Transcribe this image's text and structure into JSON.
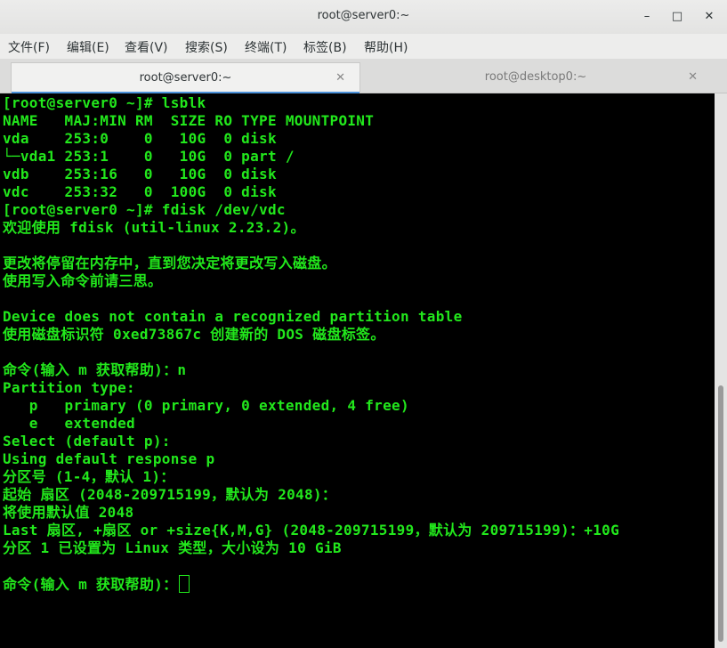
{
  "window": {
    "title": "root@server0:~",
    "controls": {
      "minimize": "–",
      "maximize": "□",
      "close": "✕"
    }
  },
  "menu": [
    "文件(F)",
    "编辑(E)",
    "查看(V)",
    "搜索(S)",
    "终端(T)",
    "标签(B)",
    "帮助(H)"
  ],
  "tabs": [
    {
      "label": "root@server0:~",
      "close": "✕",
      "active": true
    },
    {
      "label": "root@desktop0:~",
      "close": "✕",
      "active": false
    }
  ],
  "terminal": {
    "lines": [
      "[root@server0 ~]# lsblk",
      "NAME   MAJ:MIN RM  SIZE RO TYPE MOUNTPOINT",
      "vda    253:0    0   10G  0 disk",
      "└─vda1 253:1    0   10G  0 part /",
      "vdb    253:16   0   10G  0 disk",
      "vdc    253:32   0  100G  0 disk",
      "[root@server0 ~]# fdisk /dev/vdc",
      "欢迎使用 fdisk (util-linux 2.23.2)。",
      "",
      "更改将停留在内存中，直到您决定将更改写入磁盘。",
      "使用写入命令前请三思。",
      "",
      "Device does not contain a recognized partition table",
      "使用磁盘标识符 0xed73867c 创建新的 DOS 磁盘标签。",
      "",
      "命令(输入 m 获取帮助)：n",
      "Partition type:",
      "   p   primary (0 primary, 0 extended, 4 free)",
      "   e   extended",
      "Select (default p):",
      "Using default response p",
      "分区号 (1-4，默认 1)：",
      "起始 扇区 (2048-209715199，默认为 2048)：",
      "将使用默认值 2048",
      "Last 扇区, +扇区 or +size{K,M,G} (2048-209715199，默认为 209715199)：+10G",
      "分区 1 已设置为 Linux 类型，大小设为 10 GiB",
      "",
      "命令(输入 m 获取帮助)："
    ]
  },
  "colors": {
    "terminal_fg": "#22e81c",
    "terminal_bg": "#000000",
    "tab_accent": "#4a90d9"
  }
}
